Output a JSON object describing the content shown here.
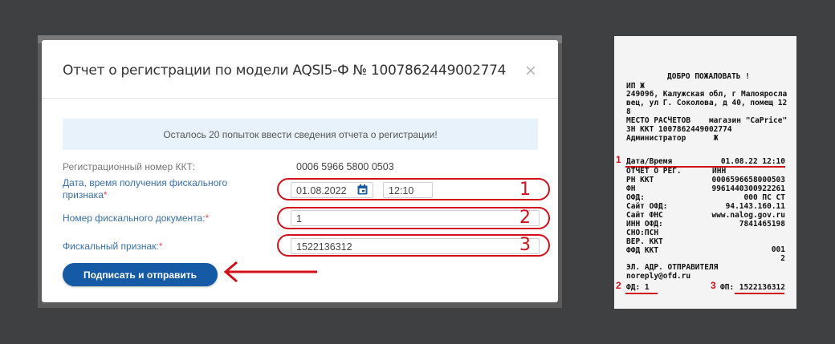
{
  "modal": {
    "title": "Отчет о регистрации по модели AQSI5-Ф № 1007862449002774",
    "close": "×",
    "notice": "Осталось 20 попыток ввести сведения отчета о регистрации!",
    "reg_number_label": "Регистрационный номер ККТ:",
    "reg_number_value": "0006 5966 5800 0503",
    "date_label": "Дата, время получения фискального признака",
    "date_value": "01.08.2022",
    "time_value": "12:10",
    "doc_label": "Номер фискального документа:",
    "doc_value": "1",
    "sign_label": "Фискальный признак:",
    "sign_value": "1522136312",
    "required_mark": "*",
    "submit": "Подписать и отправить"
  },
  "annotations": {
    "n1": "1",
    "n2": "2",
    "n3": "3",
    "arrow": "←",
    "color": "#d0101a"
  },
  "receipt": {
    "welcome": "ДОБРО ПОЖАЛОВАТЬ !",
    "lines": [
      "ИП Ж",
      "249096, Калужская обл, г Малояросла",
      "вец, ул Г. Соколова, д 40, помещ 12",
      "8",
      "МЕСТО РАСЧЕТОВ    магазин \"CaPrice\"",
      "ЗН ККТ 1007862449002774",
      "Администратор      Ж"
    ],
    "date_key": "Дата/Время",
    "date_val": "01.08.22 12:10",
    "otchet": "ОТЧЕТ О РЕГ.",
    "otchet_val": "ИНН",
    "rows": [
      {
        "k": "РН ККТ",
        "v": "0006596658000503"
      },
      {
        "k": "ФН",
        "v": "9961440300922261"
      },
      {
        "k": "ОФД:",
        "v": "000 ПС СТ"
      },
      {
        "k": "Сайт ОФД:",
        "v": "94.143.160.11"
      },
      {
        "k": "Сайт ФНС",
        "v": "www.nalog.gov.ru"
      },
      {
        "k": "ИНН ОФД:",
        "v": "7841465198"
      },
      {
        "k": "СНО:ПСН",
        "v": ""
      },
      {
        "k": "ВЕР. ККТ",
        "v": "001"
      },
      {
        "k": "ФФД ККТ",
        "v": "2"
      }
    ],
    "email_label": "ЭЛ. АДР. ОТПРАВИТЕЛЯ",
    "email": "noreply@ofd.ru",
    "fd": "ФД: 1",
    "fp_key": "ФП:",
    "fp_val": "1522136312",
    "r1": "1",
    "r2": "2",
    "r3": "3"
  }
}
